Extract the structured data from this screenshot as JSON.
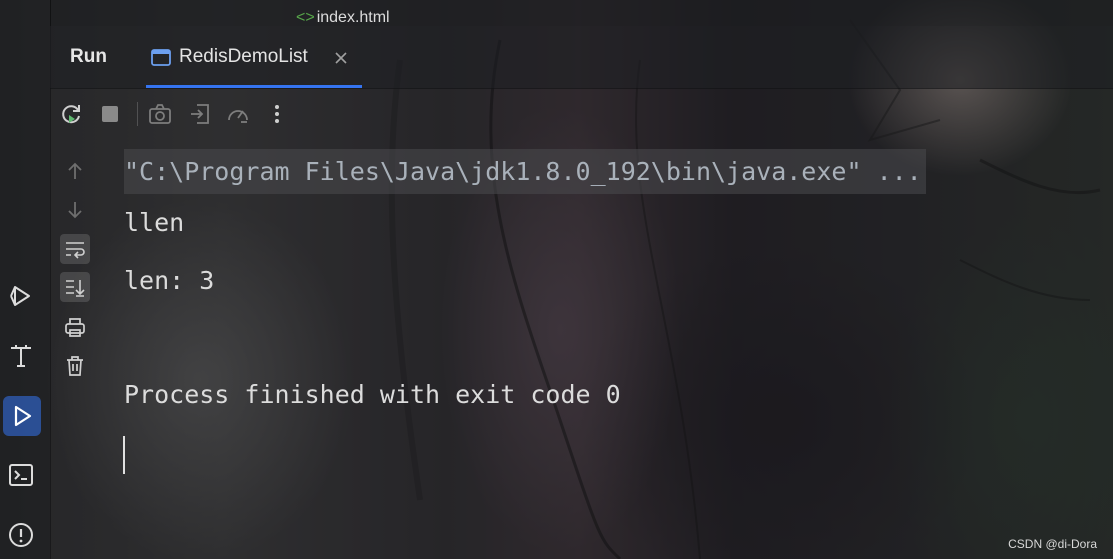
{
  "editor": {
    "tab_icon": "html-tag-icon",
    "tab_label": "index.html"
  },
  "run_window": {
    "title": "Run",
    "tab": {
      "icon": "window-icon",
      "label": "RedisDemoList",
      "close_icon": "close-icon"
    },
    "toolbar": [
      "rerun-icon",
      "stop-icon",
      "camera-icon",
      "exit-icon",
      "gauge-icon",
      "more-icon"
    ],
    "gutter": [
      "arrow-up-icon",
      "arrow-down-icon",
      "soft-wrap-icon",
      "scroll-to-end-icon",
      "print-icon",
      "trash-icon"
    ]
  },
  "left_strip": [
    "services-icon",
    "build-icon",
    "run-icon",
    "terminal-icon",
    "problems-icon"
  ],
  "console": {
    "command": "\"C:\\Program Files\\Java\\jdk1.8.0_192\\bin\\java.exe\" ...",
    "lines": [
      "llen",
      "len: 3",
      "Process finished with exit code 0"
    ]
  },
  "watermark": "CSDN @di-Dora",
  "colors": {
    "accent": "#3574f0",
    "text": "#dcdcdc",
    "command_text": "#a9b1ba",
    "html_tag": "#57a64a"
  }
}
